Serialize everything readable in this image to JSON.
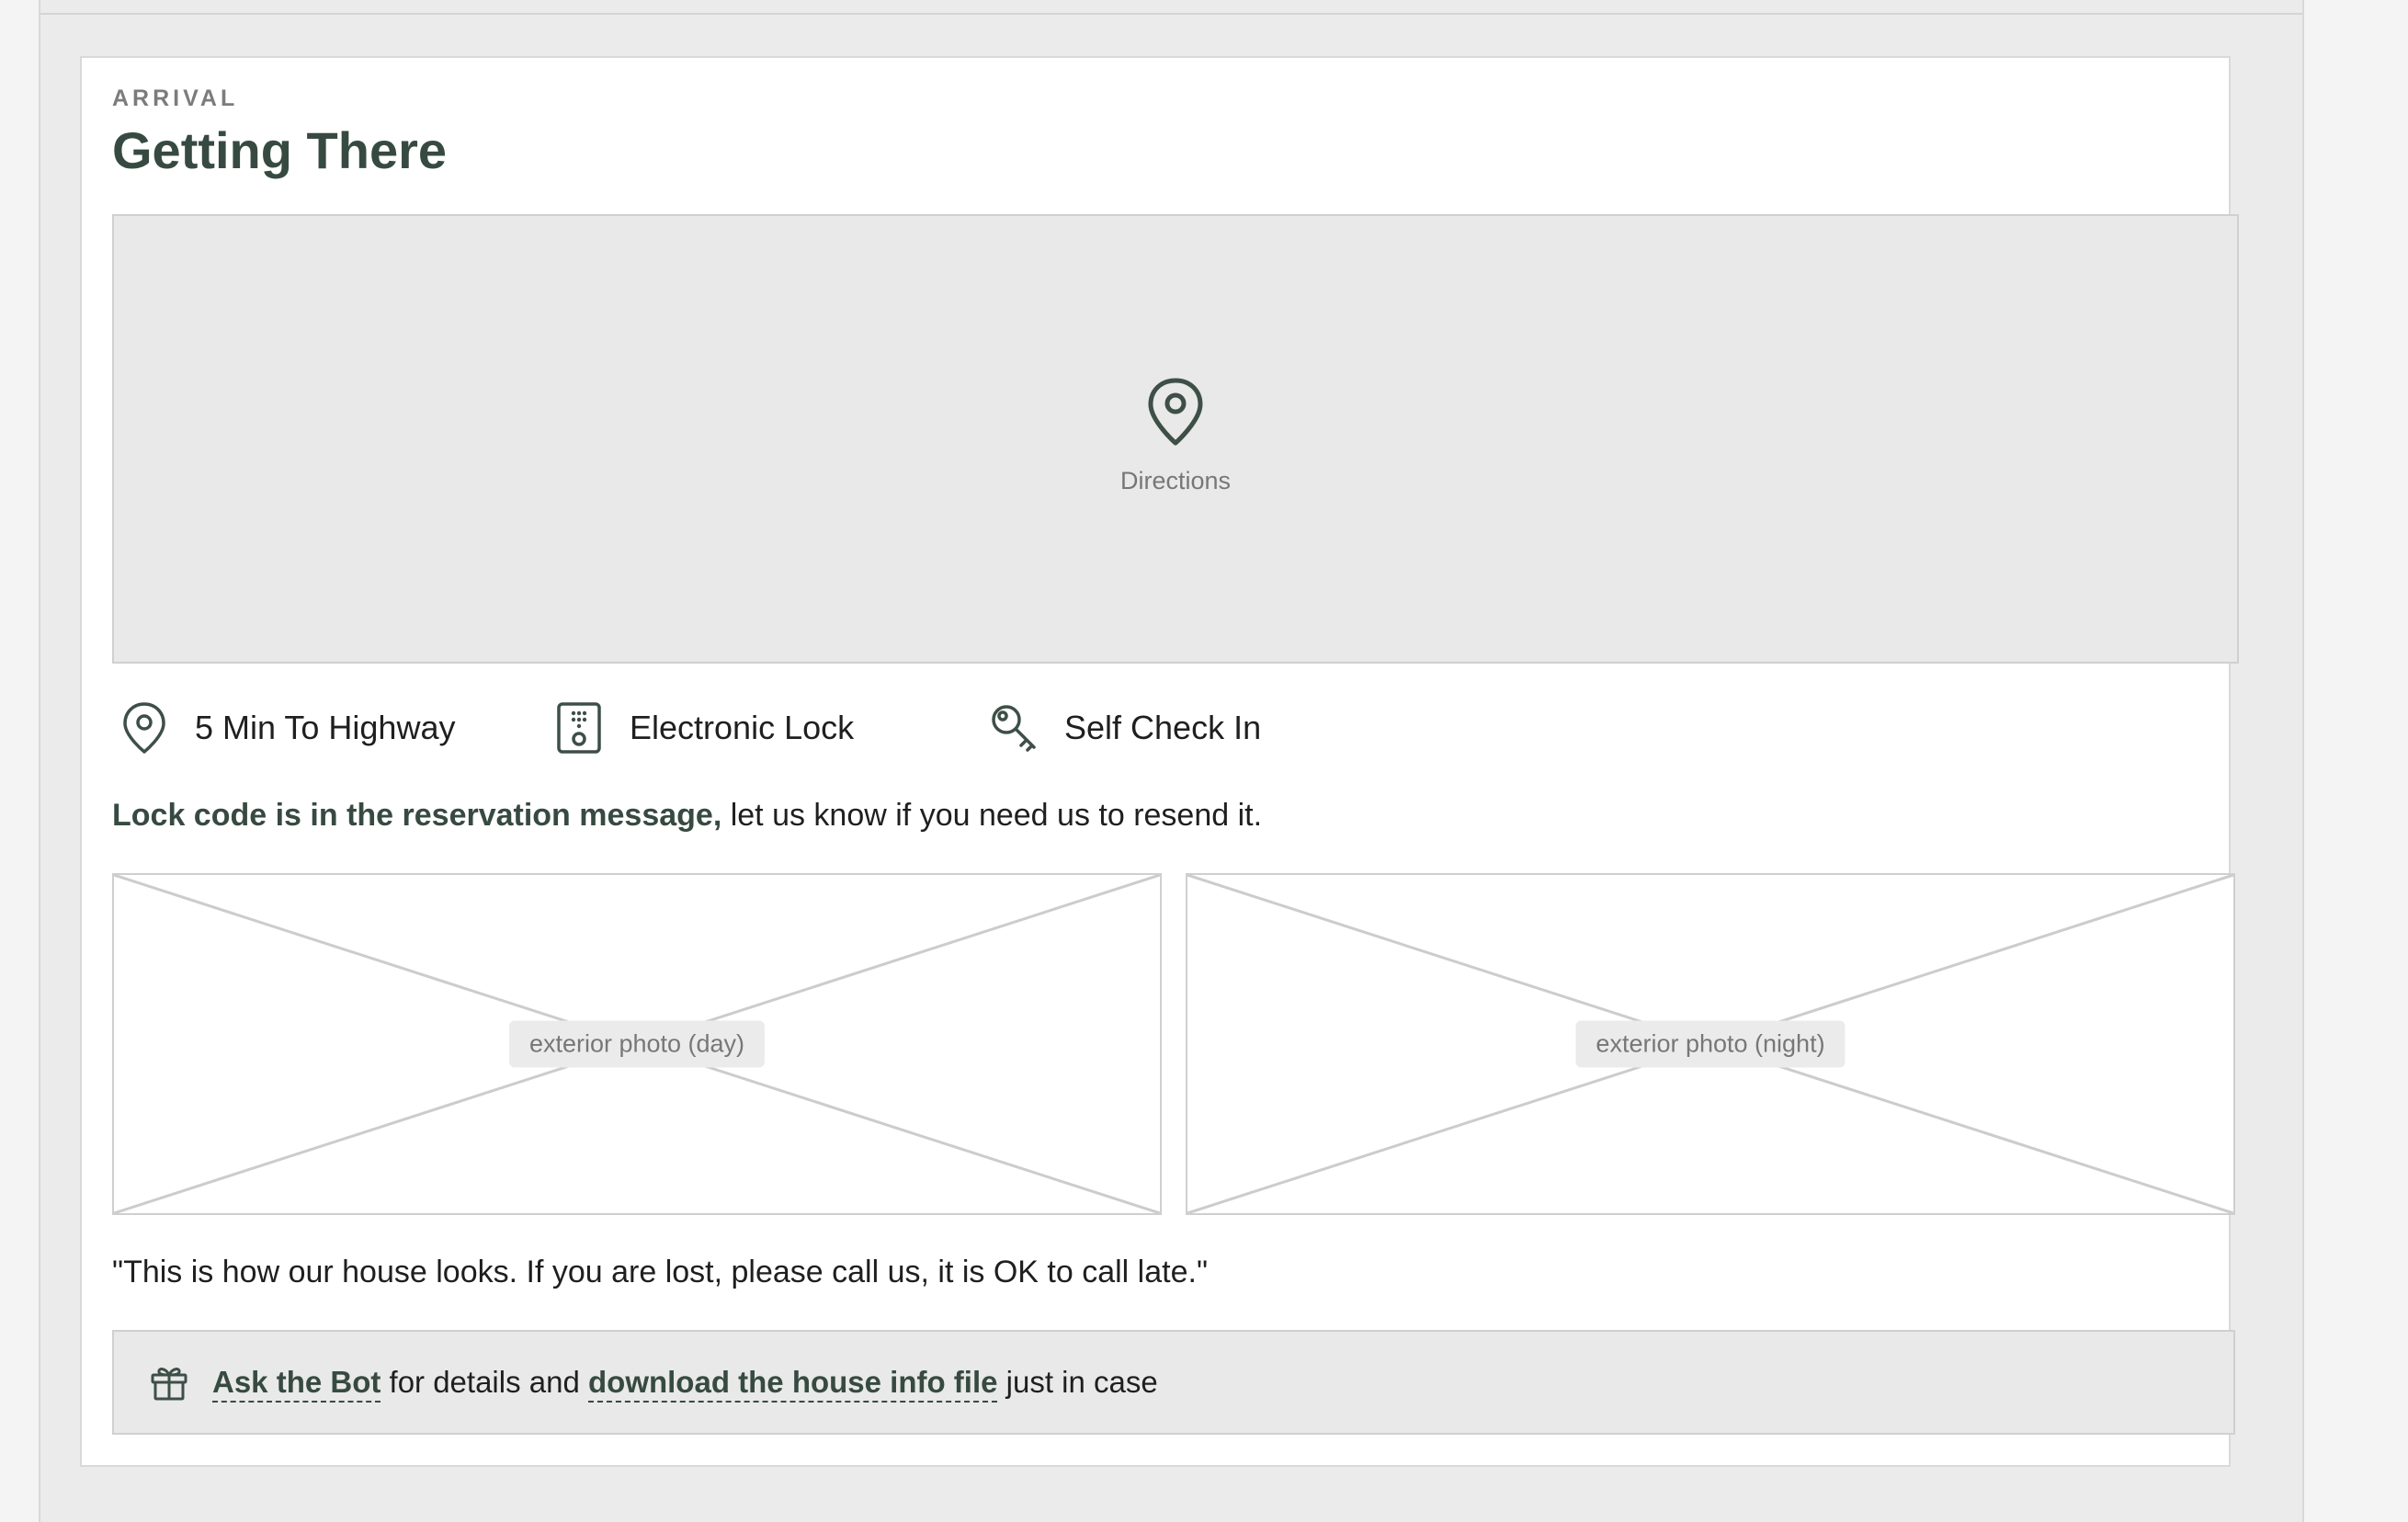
{
  "section": {
    "eyebrow": "ARRIVAL",
    "title": "Getting There"
  },
  "map": {
    "label": "Directions",
    "icon": "map-pin-icon"
  },
  "features": [
    {
      "label": "5 Min To Highway",
      "icon": "map-pin-icon"
    },
    {
      "label": "Electronic Lock",
      "icon": "keypad-lock-icon"
    },
    {
      "label": "Self Check In",
      "icon": "key-icon"
    }
  ],
  "lock_note": {
    "bold": "Lock code is in the reservation message,",
    "rest": " let us know if you need us to resend it."
  },
  "photos": [
    {
      "label": "exterior photo (day)"
    },
    {
      "label": "exterior photo (night)"
    }
  ],
  "quote": "\"This is how our house looks. If you are lost, please call us, it is OK to call late.\"",
  "footer": {
    "icon": "gift-icon",
    "link1": "Ask the Bot",
    "text1": " for details and ",
    "link2": "download the house info file",
    "text2": " just in case"
  },
  "colors": {
    "accent": "#374a41",
    "panel": "#e8e9e8",
    "border": "#d0d0d0"
  }
}
